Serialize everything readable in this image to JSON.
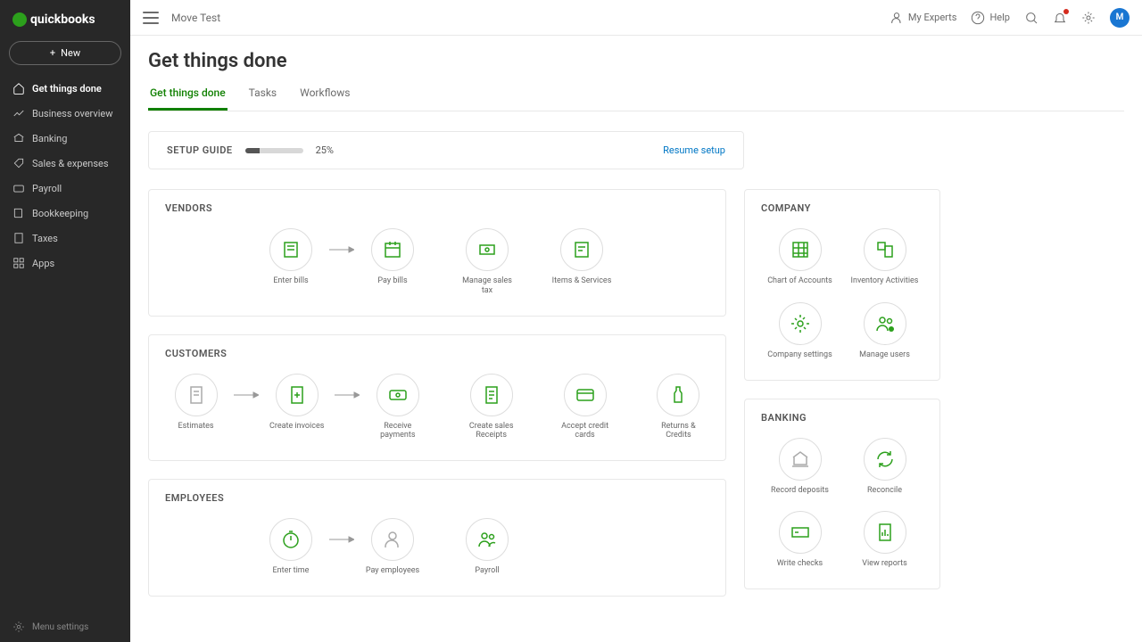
{
  "brand": "quickbooks",
  "new_button": "New",
  "sidebar": {
    "items": [
      {
        "label": "Get things done"
      },
      {
        "label": "Business overview"
      },
      {
        "label": "Banking"
      },
      {
        "label": "Sales & expenses"
      },
      {
        "label": "Payroll"
      },
      {
        "label": "Bookkeeping"
      },
      {
        "label": "Taxes"
      },
      {
        "label": "Apps"
      }
    ],
    "menu_settings": "Menu settings"
  },
  "topbar": {
    "company": "Move Test",
    "my_experts": "My Experts",
    "help": "Help",
    "avatar_initial": "M"
  },
  "page": {
    "title": "Get things done",
    "tabs": [
      {
        "label": "Get things done"
      },
      {
        "label": "Tasks"
      },
      {
        "label": "Workflows"
      }
    ]
  },
  "setup": {
    "label": "SETUP GUIDE",
    "percent": "25%",
    "percent_value": 25,
    "resume": "Resume setup"
  },
  "vendors": {
    "title": "VENDORS",
    "items": [
      {
        "label": "Enter bills"
      },
      {
        "label": "Pay bills"
      },
      {
        "label": "Manage sales tax"
      },
      {
        "label": "Items & Services"
      }
    ]
  },
  "customers": {
    "title": "CUSTOMERS",
    "items": [
      {
        "label": "Estimates"
      },
      {
        "label": "Create invoices"
      },
      {
        "label": "Receive payments"
      },
      {
        "label": "Create sales Receipts"
      },
      {
        "label": "Accept credit cards"
      },
      {
        "label": "Returns & Credits"
      }
    ]
  },
  "employees": {
    "title": "EMPLOYEES",
    "items": [
      {
        "label": "Enter time"
      },
      {
        "label": "Pay employees"
      },
      {
        "label": "Payroll"
      }
    ]
  },
  "company": {
    "title": "COMPANY",
    "items": [
      {
        "label": "Chart of Accounts"
      },
      {
        "label": "Inventory Activities"
      },
      {
        "label": "Company settings"
      },
      {
        "label": "Manage users"
      }
    ]
  },
  "banking": {
    "title": "BANKING",
    "items": [
      {
        "label": "Record deposits"
      },
      {
        "label": "Reconcile"
      },
      {
        "label": "Write checks"
      },
      {
        "label": "View reports"
      }
    ]
  }
}
